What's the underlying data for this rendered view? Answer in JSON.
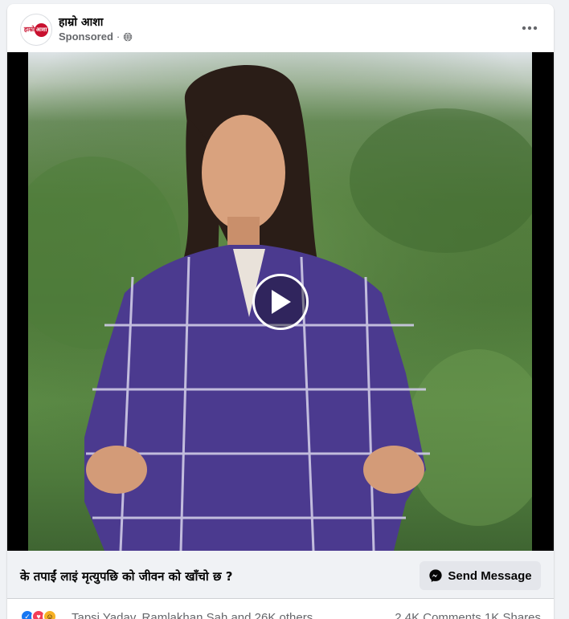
{
  "post": {
    "page_name": "हाम्रो आशा",
    "sponsored_label": "Sponsored",
    "separator": "·",
    "logo_text_left": "हाम्रो",
    "logo_text_right": "आशा",
    "privacy_icon": "globe-icon",
    "more_icon": "more-horizontal-icon"
  },
  "media": {
    "type": "video",
    "play_icon": "play-icon"
  },
  "cta": {
    "headline": "के तपाईं लाइं मृत्युपछि को जीवन को खाँचो छ ?",
    "button_label": "Send Message",
    "button_icon": "messenger-icon"
  },
  "reactions": {
    "icons": [
      "like-icon",
      "love-icon",
      "haha-icon"
    ],
    "names_text": "Tapsi Yadav, Ramlakhan Sah and 26K others",
    "comments_text": "2.4K Comments",
    "shares_text": "1K Shares"
  },
  "colors": {
    "accent": "#1877f2",
    "love": "#f33e58",
    "haha": "#f7b125",
    "secondary_text": "#65676b",
    "brand_red": "#c8102e"
  }
}
